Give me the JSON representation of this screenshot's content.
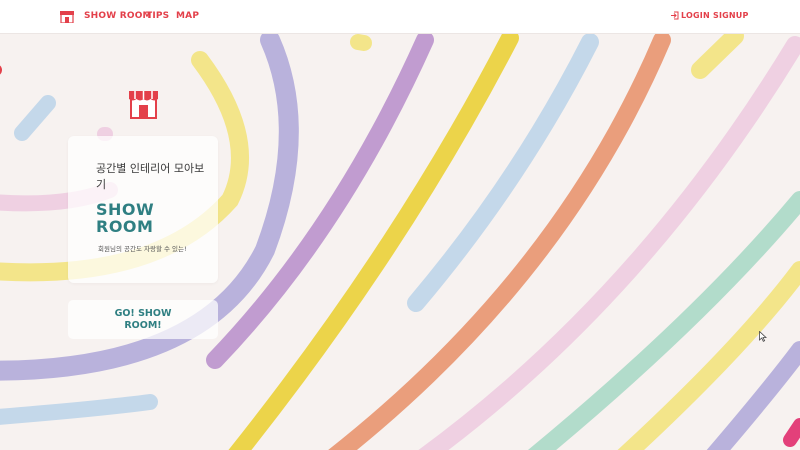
{
  "header": {
    "nav": {
      "showroom": "SHOW ROOM",
      "tips": "TIPS",
      "map": "MAP",
      "login": "LOGIN",
      "signup": "SIGNUP"
    }
  },
  "hero": {
    "title": "공간별 인테리어 모아보기",
    "brand_line1": "SHOW",
    "brand_line2": "ROOM",
    "subtitle": "회원님의 공간도 자랑할 수 있는!",
    "cta_label": "GO! SHOW ROOM!"
  },
  "colors": {
    "background": "#f7f2f0",
    "nav_accent": "#e3404a",
    "brand": "#2f7f82",
    "stripes": [
      "#b9b2dc",
      "#c19cd0",
      "#ecd44a",
      "#c4d8ea",
      "#ea9e7c",
      "#efd0e2",
      "#b2dccb",
      "#f3e58a"
    ]
  },
  "icons": {
    "logo": "store-icon",
    "login": "login-icon",
    "cursor": "mouse-cursor-icon"
  }
}
